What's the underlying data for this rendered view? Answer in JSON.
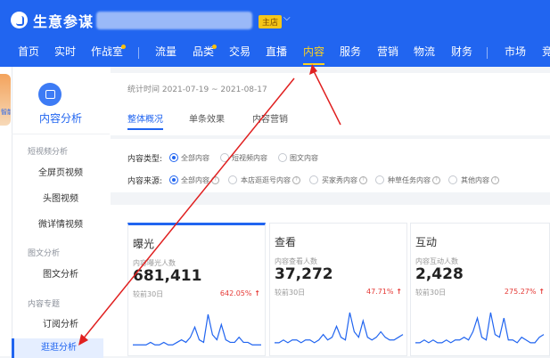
{
  "app": {
    "title": "生意参谋",
    "shop_badge": "主店",
    "shop_caret": "⌵"
  },
  "nav": {
    "items": [
      {
        "label": "首页"
      },
      {
        "label": "实时"
      },
      {
        "label": "作战室"
      },
      {
        "label": "流量"
      },
      {
        "label": "品类"
      },
      {
        "label": "交易"
      },
      {
        "label": "直播"
      },
      {
        "label": "内容"
      },
      {
        "label": "服务"
      },
      {
        "label": "营销"
      },
      {
        "label": "物流"
      },
      {
        "label": "财务"
      },
      {
        "label": "市场"
      },
      {
        "label": "竞"
      }
    ],
    "active": "内容"
  },
  "mascot_label": "智能助手",
  "sidebar": {
    "title": "内容分析",
    "groups": [
      {
        "label": "短视频分析",
        "items": [
          "全屏页视频",
          "头图视频",
          "微详情视频"
        ]
      },
      {
        "label": "图文分析",
        "items": [
          "图文分析"
        ]
      },
      {
        "label": "内容专题",
        "items": [
          "订阅分析",
          "逛逛分析"
        ]
      }
    ],
    "active_item": "逛逛分析"
  },
  "main": {
    "stat_time": "统计时间 2021-07-19 ~ 2021-08-17",
    "tabs": [
      "整体概况",
      "单条效果",
      "内容营销"
    ],
    "active_tab": "整体概况"
  },
  "filters": {
    "type": {
      "label": "内容类型:",
      "options": [
        "全部内容",
        "短视频内容",
        "图文内容"
      ],
      "selected": "全部内容"
    },
    "source": {
      "label": "内容来源:",
      "options": [
        "全部内容",
        "本店逛逛号内容",
        "买家秀内容",
        "种草任务内容",
        "其他内容"
      ],
      "selected": "全部内容"
    }
  },
  "metrics": [
    {
      "title": "曝光",
      "sub": "内容曝光人数",
      "value": "681,411",
      "cmp": "较前30日",
      "pct": "642.05%",
      "series": [
        2,
        2,
        2,
        2,
        3,
        2,
        2,
        3,
        2,
        2,
        3,
        4,
        3,
        5,
        9,
        4,
        3,
        14,
        6,
        4,
        10,
        4,
        3,
        3,
        5,
        3,
        3,
        2,
        2,
        2
      ]
    },
    {
      "title": "查看",
      "sub": "内容查看人数",
      "value": "37,272",
      "cmp": "较前30日",
      "pct": "47.71%",
      "series": [
        2,
        2,
        3,
        2,
        3,
        3,
        2,
        3,
        3,
        2,
        3,
        5,
        3,
        4,
        8,
        4,
        3,
        13,
        6,
        4,
        10,
        4,
        3,
        4,
        6,
        4,
        3,
        3,
        4,
        5
      ]
    },
    {
      "title": "互动",
      "sub": "内容互动人数",
      "value": "2,428",
      "cmp": "较前30日",
      "pct": "275.27%",
      "series": [
        2,
        2,
        3,
        2,
        3,
        2,
        2,
        3,
        2,
        3,
        3,
        4,
        3,
        6,
        11,
        4,
        3,
        13,
        5,
        4,
        11,
        3,
        3,
        2,
        4,
        3,
        2,
        2,
        4,
        5
      ]
    }
  ],
  "colors": {
    "brand": "#2165f0",
    "accent": "#ffd21f",
    "arrow": "#e02020"
  }
}
